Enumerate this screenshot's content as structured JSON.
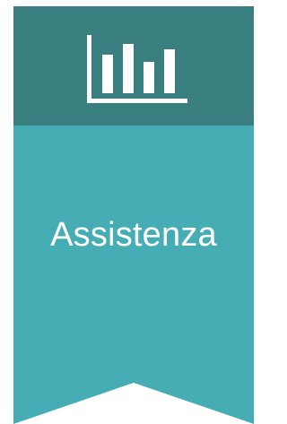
{
  "banner": {
    "label": "Assistenza",
    "icon": "bar-chart-icon",
    "colors": {
      "header": "#3a7f80",
      "body": "#46adb4",
      "icon": "#ffffff",
      "text": "#ffffff"
    }
  }
}
